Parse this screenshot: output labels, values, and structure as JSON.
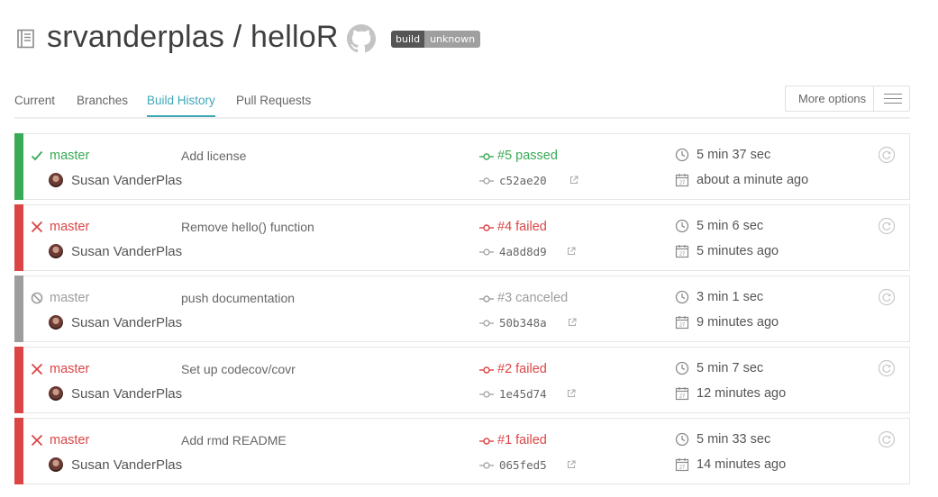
{
  "header": {
    "repo_title": "srvanderplas / helloR",
    "badge_left": "build",
    "badge_right": "unknown"
  },
  "tabs": [
    {
      "label": "Current",
      "active": false
    },
    {
      "label": "Branches",
      "active": false
    },
    {
      "label": "Build History",
      "active": true
    },
    {
      "label": "Pull Requests",
      "active": false
    }
  ],
  "more_options": {
    "label": "More options"
  },
  "colors": {
    "passed": "#39aa56",
    "failed": "#db4545",
    "canceled": "#9d9d9d",
    "accent": "#3ea7b5"
  },
  "builds": [
    {
      "status": "passed",
      "status_icon": "check-icon",
      "branch": "master",
      "message": "Add license",
      "author": "Susan VanderPlas",
      "build_label": "#5 passed",
      "sha": "c52ae20",
      "duration": "5 min 37 sec",
      "finished": "about a minute ago"
    },
    {
      "status": "failed",
      "status_icon": "x-icon",
      "branch": "master",
      "message": "Remove hello() function",
      "author": "Susan VanderPlas",
      "build_label": "#4 failed",
      "sha": "4a8d8d9",
      "duration": "5 min 6 sec",
      "finished": "5 minutes ago"
    },
    {
      "status": "canceled",
      "status_icon": "canceled-icon",
      "branch": "master",
      "message": "push documentation",
      "author": "Susan VanderPlas",
      "build_label": "#3 canceled",
      "sha": "50b348a",
      "duration": "3 min 1 sec",
      "finished": "9 minutes ago"
    },
    {
      "status": "failed",
      "status_icon": "x-icon",
      "branch": "master",
      "message": "Set up codecov/covr",
      "author": "Susan VanderPlas",
      "build_label": "#2 failed",
      "sha": "1e45d74",
      "duration": "5 min 7 sec",
      "finished": "12 minutes ago"
    },
    {
      "status": "failed",
      "status_icon": "x-icon",
      "branch": "master",
      "message": "Add rmd README",
      "author": "Susan VanderPlas",
      "build_label": "#1 failed",
      "sha": "065fed5",
      "duration": "5 min 33 sec",
      "finished": "14 minutes ago"
    }
  ]
}
